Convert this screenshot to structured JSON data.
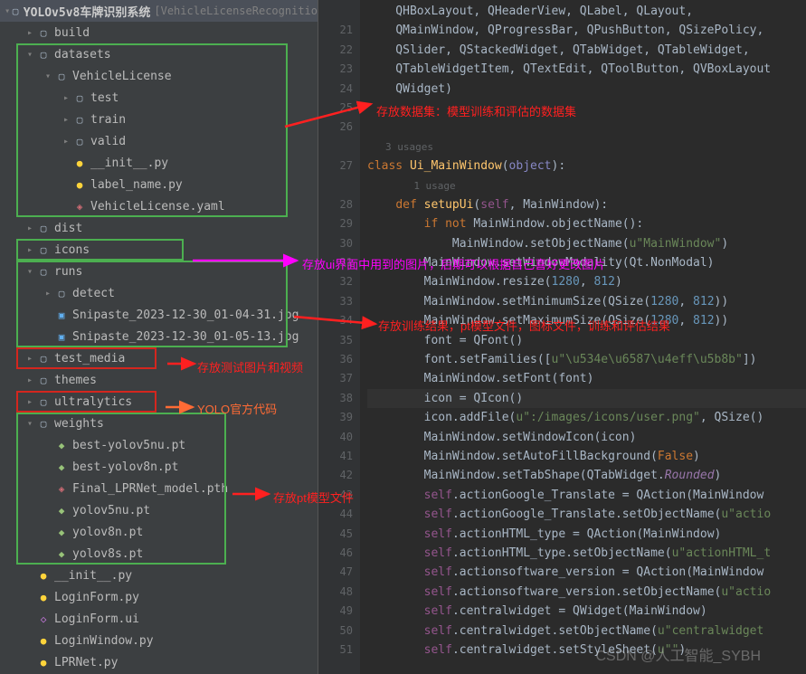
{
  "root": {
    "name": "YOLOv5v8车牌识别系统",
    "extra": "[VehicleLicenseRecognitio"
  },
  "tree": [
    {
      "d": 1,
      "c": ">",
      "i": "folder",
      "t": "build"
    },
    {
      "d": 1,
      "c": "v",
      "i": "folder",
      "t": "datasets",
      "boxStart": "green1"
    },
    {
      "d": 2,
      "c": "v",
      "i": "folder",
      "t": "VehicleLicense"
    },
    {
      "d": 3,
      "c": ">",
      "i": "folder",
      "t": "test"
    },
    {
      "d": 3,
      "c": ">",
      "i": "folder",
      "t": "train"
    },
    {
      "d": 3,
      "c": ">",
      "i": "folder",
      "t": "valid"
    },
    {
      "d": 3,
      "c": "",
      "i": "py",
      "t": "__init__.py"
    },
    {
      "d": 3,
      "c": "",
      "i": "py",
      "t": "label_name.py"
    },
    {
      "d": 3,
      "c": "",
      "i": "yaml",
      "t": "VehicleLicense.yaml",
      "boxEnd": "green1"
    },
    {
      "d": 1,
      "c": ">",
      "i": "folder",
      "t": "dist"
    },
    {
      "d": 1,
      "c": ">",
      "i": "folder",
      "t": "icons",
      "boxSingle": "green2"
    },
    {
      "d": 1,
      "c": "v",
      "i": "folder",
      "t": "runs",
      "boxStart": "green3"
    },
    {
      "d": 2,
      "c": ">",
      "i": "folder",
      "t": "detect"
    },
    {
      "d": 2,
      "c": "",
      "i": "img",
      "t": "Snipaste_2023-12-30_01-04-31.jpg"
    },
    {
      "d": 2,
      "c": "",
      "i": "img",
      "t": "Snipaste_2023-12-30_01-05-13.jpg",
      "boxEnd": "green3"
    },
    {
      "d": 1,
      "c": ">",
      "i": "folder",
      "t": "test_media",
      "boxSingle": "red1"
    },
    {
      "d": 1,
      "c": ">",
      "i": "folder",
      "t": "themes"
    },
    {
      "d": 1,
      "c": ">",
      "i": "folder",
      "t": "ultralytics",
      "boxSingle": "red2"
    },
    {
      "d": 1,
      "c": "v",
      "i": "folder",
      "t": "weights",
      "boxStart": "green4"
    },
    {
      "d": 2,
      "c": "",
      "i": "pt",
      "t": "best-yolov5nu.pt"
    },
    {
      "d": 2,
      "c": "",
      "i": "pt",
      "t": "best-yolov8n.pt"
    },
    {
      "d": 2,
      "c": "",
      "i": "yaml",
      "t": "Final_LPRNet_model.pth"
    },
    {
      "d": 2,
      "c": "",
      "i": "pt",
      "t": "yolov5nu.pt"
    },
    {
      "d": 2,
      "c": "",
      "i": "pt",
      "t": "yolov8n.pt"
    },
    {
      "d": 2,
      "c": "",
      "i": "pt",
      "t": "yolov8s.pt",
      "boxEnd": "green4"
    },
    {
      "d": 1,
      "c": "",
      "i": "py",
      "t": "__init__.py"
    },
    {
      "d": 1,
      "c": "",
      "i": "py",
      "t": "LoginForm.py"
    },
    {
      "d": 1,
      "c": "",
      "i": "ui",
      "t": "LoginForm.ui"
    },
    {
      "d": 1,
      "c": "",
      "i": "py",
      "t": "LoginWindow.py"
    },
    {
      "d": 1,
      "c": "",
      "i": "py",
      "t": "LPRNet.py"
    }
  ],
  "annotations": {
    "a1": "存放数据集：模型训练和评估的数据集",
    "a2": "存放ui界面中用到的图片，后期可以根据自己喜好更改图片",
    "a3": "存放训练结果，pt模型文件，图标文件，训练和评估结果",
    "a4": "存放测试图片和视频",
    "a5": "YOLO官方代码",
    "a6": "存放pt模型文件"
  },
  "gutter_start": 20,
  "code_lines": [
    {
      "n": "",
      "t": "    QHBoxLayout, QHeaderView, QLabel, QLayout,"
    },
    {
      "n": "21",
      "t": "    <span class='cls'>QMainWindow</span>, QProgressBar, QPushButton, QSizePolicy,"
    },
    {
      "n": "22",
      "t": "    QSlider, QStackedWidget, QTabWidget, QTableWidget,"
    },
    {
      "n": "23",
      "t": "    QTableWidgetItem, QTextEdit, QToolButton, QVBoxLayout"
    },
    {
      "n": "24",
      "t": "    QWidget)"
    },
    {
      "n": "25",
      "t": ""
    },
    {
      "n": "26",
      "t": ""
    },
    {
      "n": "",
      "t": "<span class='small-hint'>3 usages</span>"
    },
    {
      "n": "27",
      "t": "<span class='kw'>class</span> <span class='fn'>Ui_MainWindow</span>(<span class='builtin'>object</span>):",
      "icon": "◉"
    },
    {
      "n": "",
      "t": "    <span class='small-hint'>1 usage</span>"
    },
    {
      "n": "28",
      "t": "    <span class='kw'>def</span> <span class='fn'>setupUi</span>(<span class='self'>self</span>, MainWindow):",
      "icon": "◉"
    },
    {
      "n": "29",
      "t": "        <span class='kw'>if not</span> MainWindow.objectName():"
    },
    {
      "n": "30",
      "t": "            MainWindow.setObjectName(<span class='str'>u\"MainWindow\"</span>)"
    },
    {
      "n": "31",
      "t": "        MainWindow.setWindowModality(Qt.NonModal)"
    },
    {
      "n": "32",
      "t": "        MainWindow.resize(<span class='num'>1280</span>, <span class='num'>812</span>)"
    },
    {
      "n": "33",
      "t": "        MainWindow.setMinimumSize(QSize(<span class='num'>1280</span>, <span class='num'>812</span>))"
    },
    {
      "n": "34",
      "t": "        MainWindow.setMaximumSize(QSize(<span class='num'>1280</span>, <span class='num'>812</span>))"
    },
    {
      "n": "35",
      "t": "        font = QFont()"
    },
    {
      "n": "36",
      "t": "        font.setFamilies([<span class='str'>u\"\\u534e\\u6587\\u4eff\\u5b8b\"</span>])"
    },
    {
      "n": "37",
      "t": "        MainWindow.setFont(font)"
    },
    {
      "n": "38",
      "t": "        icon = QIcon()",
      "hl": true
    },
    {
      "n": "39",
      "t": "        icon.addFile(<span class='str'>u\":/images/icons/user.png\"</span>, QSize()"
    },
    {
      "n": "40",
      "t": "        MainWindow.setWindowIcon(icon)"
    },
    {
      "n": "41",
      "t": "        MainWindow.setAutoFillBackground(<span class='kw'>False</span>)"
    },
    {
      "n": "42",
      "t": "        MainWindow.setTabShape(QTabWidget.<span class='prop'>Rounded</span>)"
    },
    {
      "n": "43",
      "t": "        <span class='self'>self</span>.actionGoogle_Translate = QAction(MainWindow"
    },
    {
      "n": "44",
      "t": "        <span class='self'>self</span>.actionGoogle_Translate.setObjectName(<span class='str'>u\"actio</span>"
    },
    {
      "n": "45",
      "t": "        <span class='self'>self</span>.actionHTML_type = QAction(MainWindow)"
    },
    {
      "n": "46",
      "t": "        <span class='self'>self</span>.actionHTML_type.setObjectName(<span class='str'>u\"actionHTML_t</span>"
    },
    {
      "n": "47",
      "t": "        <span class='self'>self</span>.actionsoftware_version = QAction(MainWindow"
    },
    {
      "n": "48",
      "t": "        <span class='self'>self</span>.actionsoftware_version.setObjectName(<span class='str'>u\"actio</span>"
    },
    {
      "n": "49",
      "t": "        <span class='self'>self</span>.centralwidget = QWidget(MainWindow)"
    },
    {
      "n": "50",
      "t": "        <span class='self'>self</span>.centralwidget.setObjectName(<span class='str'>u\"centralwidget</span>"
    },
    {
      "n": "51",
      "t": "        <span class='self'>self</span>.centralwidget.setStyleSheet(<span class='str'>u\"\"</span>)"
    }
  ],
  "watermark": "CSDN @人工智能_SYBH"
}
